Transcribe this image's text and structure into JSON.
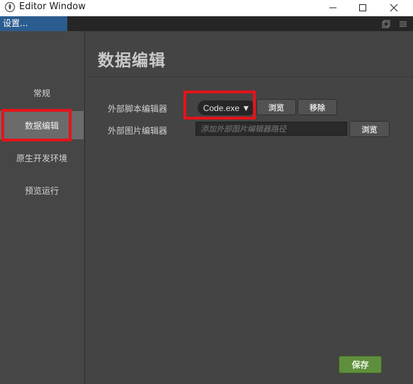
{
  "window": {
    "title": "Editor Window"
  },
  "tab": {
    "label": "设置..."
  },
  "sidebar": {
    "items": [
      {
        "label": "常规",
        "active": false
      },
      {
        "label": "数据编辑",
        "active": true
      },
      {
        "label": "原生开发环境",
        "active": false
      },
      {
        "label": "预览运行",
        "active": false
      }
    ]
  },
  "main": {
    "title": "数据编辑",
    "script_editor": {
      "label": "外部脚本编辑器",
      "selected": "Code.exe ▼",
      "browse_label": "浏览",
      "remove_label": "移除"
    },
    "image_editor": {
      "label": "外部图片编辑器",
      "placeholder": "添加外部图片编辑器路径",
      "browse_label": "浏览"
    },
    "save_label": "保存"
  },
  "colors": {
    "highlight": "#e3141b",
    "save_button": "#5f8f3c",
    "tab_active": "#2b5c8f"
  }
}
